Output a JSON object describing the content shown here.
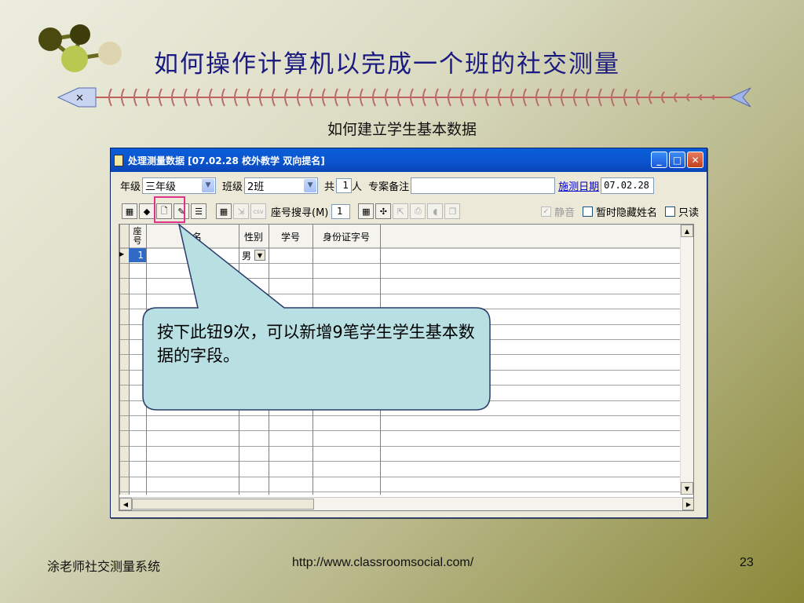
{
  "slide": {
    "title": "如何操作计算机以完成一个班的社交测量",
    "subtitle": "如何建立学生基本数据",
    "footer_left": "涂老师社交测量系统",
    "footer_center": "http://www.classroomsocial.com/",
    "page_number": "23"
  },
  "window": {
    "title": "处理测量数据 [07.02.28  校外教学  双向提名]",
    "grade_label": "年级",
    "grade_value": "三年级",
    "class_label": "班级",
    "class_value": "2班",
    "total_prefix": "共",
    "total_count": "1",
    "total_suffix": "人",
    "remark_label": "专案备注",
    "remark_value": "",
    "date_label": "施测日期",
    "date_value": "07.02.28",
    "search_label": "座号搜寻(M)",
    "search_value": "1",
    "csv_label": "csv",
    "mute_label": "静音",
    "hide_names_label": "暂时隐藏姓名",
    "readonly_label": "只读"
  },
  "grid": {
    "columns": [
      "座号",
      "姓名",
      "性别",
      "学号",
      "身份证字号"
    ],
    "rows": [
      {
        "seat": "1",
        "name": "",
        "gender": "男",
        "student_id": "",
        "id_number": ""
      }
    ]
  },
  "callout": {
    "text": "按下此钮9次，可以新增9笔学生学生基本数据的字段。"
  },
  "colors": {
    "title_blue": "#1a1a80",
    "highlight": "#e0308c",
    "callout_fill": "#b8dfe2",
    "titlebar": "#0b55d0"
  }
}
